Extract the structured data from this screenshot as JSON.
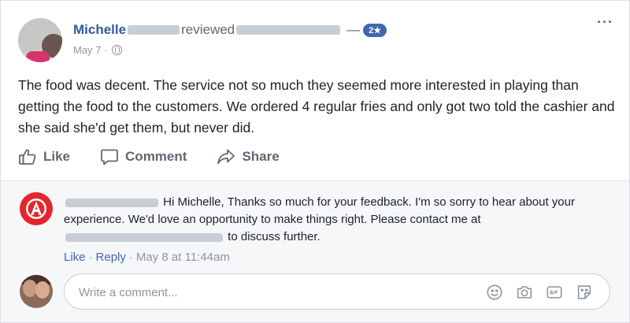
{
  "post": {
    "author": "Michelle",
    "action": "reviewed",
    "dash": "—",
    "rating": "2★",
    "date": "May 7 ·",
    "more": "···",
    "text": "The food was decent. The service not so much they seemed more interested in playing than getting the food to the customers. We ordered 4 regular fries and only got two told the cashier and she said she'd get them, but never did."
  },
  "actions": {
    "like": "Like",
    "comment": "Comment",
    "share": "Share"
  },
  "reply": {
    "text_part1": "Hi Michelle, Thanks so much for your feedback. I'm so sorry to hear about your experience. We'd love an opportunity to make things right. Please contact me at",
    "text_part2": "to discuss further.",
    "like": "Like",
    "sep1": "·",
    "reply": "Reply",
    "sep2": "·",
    "time": "May 8 at 11:44am"
  },
  "comment_box": {
    "placeholder": "Write a comment..."
  },
  "icons": {
    "like": "thumbs-up-icon",
    "comment": "speech-bubble-icon",
    "share": "share-arrow-icon",
    "globe": "globe-icon",
    "emoji": "smiley-icon",
    "camera": "camera-icon",
    "gif": "gif-icon",
    "sticker": "sticker-icon"
  },
  "colors": {
    "link": "#365899",
    "accent": "#4267b2",
    "muted": "#90949c",
    "page_avatar": "#e2262c"
  }
}
